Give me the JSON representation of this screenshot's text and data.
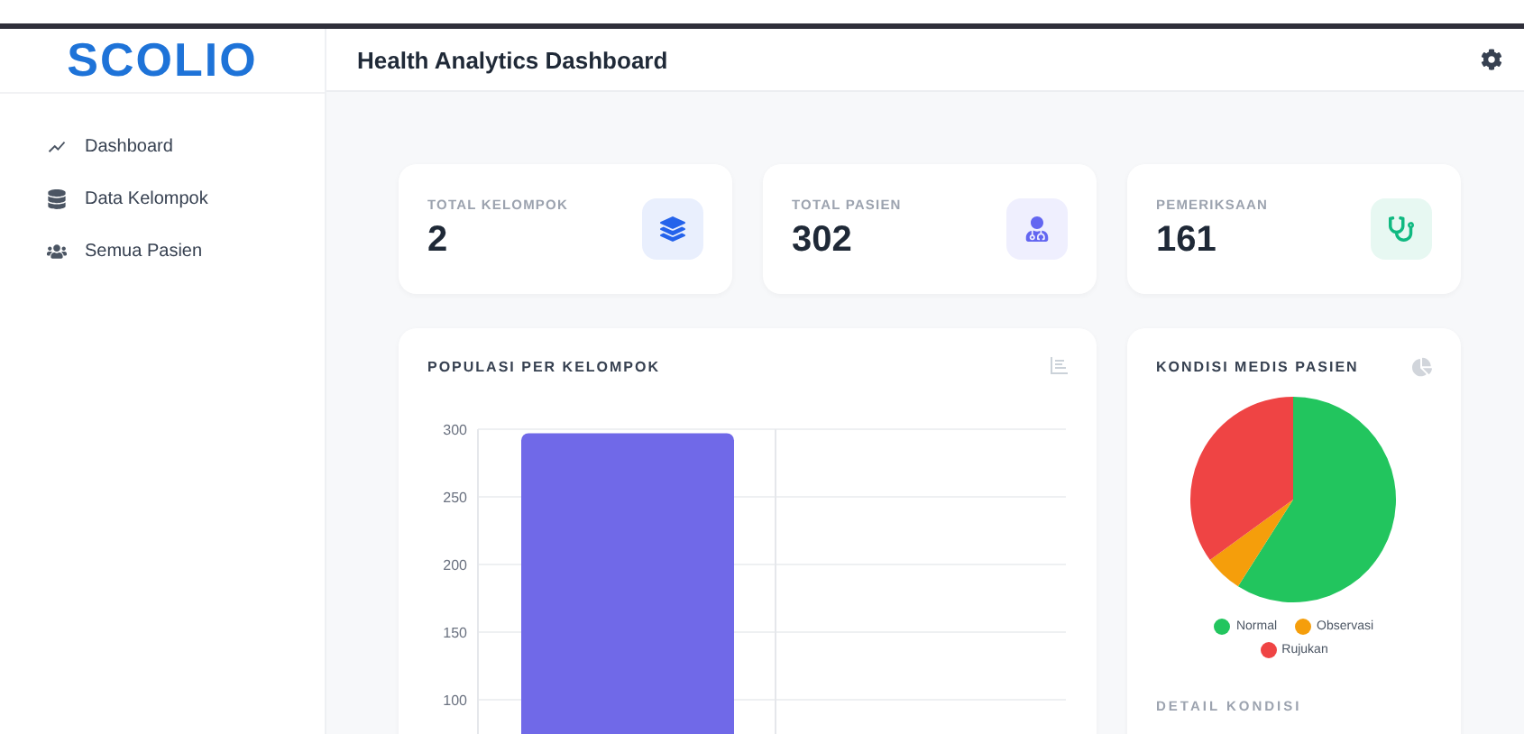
{
  "brand": {
    "logo": "SCOLIO"
  },
  "sidebar": {
    "items": [
      {
        "label": "Dashboard"
      },
      {
        "label": "Data Kelompok"
      },
      {
        "label": "Semua Pasien"
      }
    ]
  },
  "header": {
    "title": "Health Analytics Dashboard"
  },
  "stats": [
    {
      "label": "TOTAL KELOMPOK",
      "value": "2",
      "color": "#2563eb"
    },
    {
      "label": "TOTAL PASIEN",
      "value": "302",
      "color": "#6366f1"
    },
    {
      "label": "PEMERIKSAAN",
      "value": "161",
      "color": "#10b981"
    }
  ],
  "population": {
    "title": "POPULASI PER KELOMPOK",
    "chart_data": {
      "type": "bar",
      "grid": true,
      "ylim": [
        0,
        300
      ],
      "yticks": [
        100,
        150,
        200,
        250,
        300
      ],
      "series": [
        {
          "color": "#7069e8",
          "values": [
            297,
            null
          ]
        }
      ]
    }
  },
  "conditions": {
    "title": "KONDISI MEDIS PASIEN",
    "chart_data": {
      "type": "pie",
      "categories": [
        "Normal",
        "Observasi",
        "Rujukan"
      ],
      "series": [
        {
          "values": [
            59,
            6,
            35
          ]
        }
      ]
    },
    "slice_colors": [
      {
        "color": "#22c55e"
      },
      {
        "color": "#f59e0b"
      },
      {
        "color": "#ef4444"
      }
    ],
    "detail_title": "DETAIL KONDISI"
  }
}
